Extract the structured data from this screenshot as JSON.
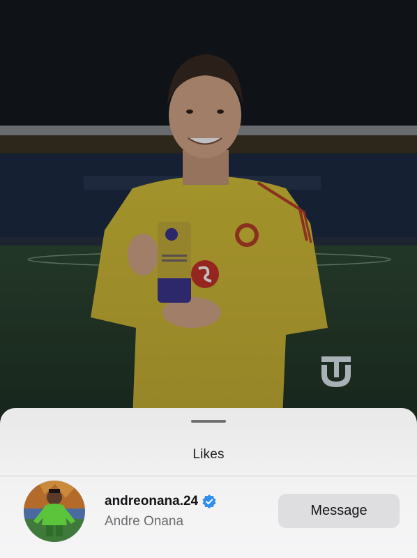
{
  "sheet": {
    "title": "Likes"
  },
  "like_row": {
    "username": "andreonana.24",
    "full_name": "Andre Onana",
    "verified": true,
    "message_button_label": "Message"
  },
  "icons": {
    "verified": "verified-badge-icon",
    "watermark": "tu-logo-icon"
  },
  "colors": {
    "verified_blue": "#2f8cf0",
    "jersey_yellow": "#d8c22e",
    "button_grey": "#dedee1"
  }
}
